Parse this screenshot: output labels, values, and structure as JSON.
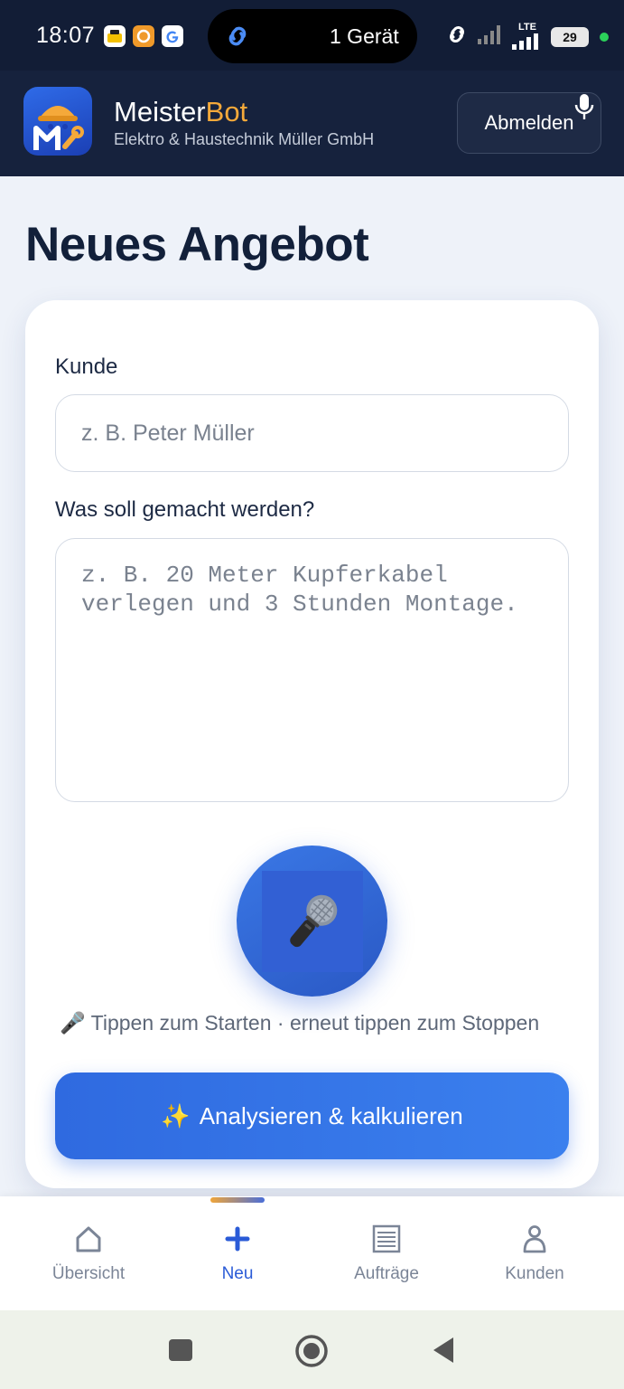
{
  "status_bar": {
    "time": "18:07",
    "pill_text": "1 Gerät",
    "network": "LTE",
    "battery": "29",
    "app_icons": [
      "adac-icon",
      "app-c-icon",
      "google-icon"
    ]
  },
  "header": {
    "brand_primary": "Meister",
    "brand_accent": "Bot",
    "company": "Elektro & Haustechnik Müller GmbH",
    "logout_label": "Abmelden",
    "accent_color": "#f5a93a"
  },
  "page": {
    "title": "Neues Angebot"
  },
  "form": {
    "customer_label": "Kunde",
    "customer_placeholder": "z. B. Peter Müller",
    "customer_value": "",
    "task_label": "Was soll gemacht werden?",
    "task_placeholder": "z. B. 20 Meter Kupferkabel verlegen und 3 Stunden Montage.",
    "task_value": "",
    "mic_icon": "microphone-icon",
    "hint_icon": "🎤",
    "hint": "Tippen zum Starten · erneut tippen zum Stoppen",
    "analyze_icon": "✨",
    "analyze_label": "Analysieren & kalkulieren",
    "primary_color": "#2f6ae0"
  },
  "bottom_nav": {
    "items": [
      {
        "label": "Übersicht",
        "icon": "home-icon",
        "active": false
      },
      {
        "label": "Neu",
        "icon": "plus-icon",
        "active": true
      },
      {
        "label": "Aufträge",
        "icon": "list-icon",
        "active": false
      },
      {
        "label": "Kunden",
        "icon": "person-icon",
        "active": false
      }
    ]
  },
  "system_nav": {
    "buttons": [
      "recents-button",
      "home-button",
      "back-button"
    ]
  }
}
